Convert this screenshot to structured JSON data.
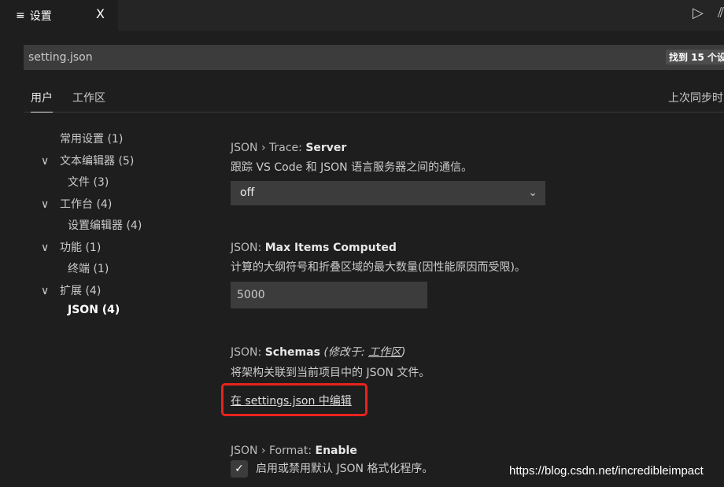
{
  "tab": {
    "icon": "menu-lines-icon",
    "label": "设置",
    "close": "X"
  },
  "actions": {
    "run": "▷",
    "split": "⫽"
  },
  "search": {
    "value": "setting.json",
    "count": "找到 15 个设"
  },
  "scope_tabs": [
    {
      "label": "用户",
      "active": true
    },
    {
      "label": "工作区",
      "active": false
    }
  ],
  "sync": "上次同步时",
  "toc": [
    {
      "label": "常用设置 (1)",
      "chev": ""
    },
    {
      "label": "文本编辑器 (5)",
      "chev": "∨"
    },
    {
      "label": "文件 (3)",
      "chev": "",
      "indent": true
    },
    {
      "label": "工作台 (4)",
      "chev": "∨"
    },
    {
      "label": "设置编辑器 (4)",
      "chev": "",
      "indent": true
    },
    {
      "label": "功能 (1)",
      "chev": "∨"
    },
    {
      "label": "终端 (1)",
      "chev": "",
      "indent": true
    },
    {
      "label": "扩展 (4)",
      "chev": "∨"
    },
    {
      "label": "JSON (4)",
      "chev": "",
      "indent": true,
      "active": true
    }
  ],
  "settings": {
    "trace": {
      "prefix": "JSON › Trace: ",
      "name": "Server",
      "desc": "跟踪 VS Code 和 JSON 语言服务器之间的通信。",
      "value": "off"
    },
    "max": {
      "prefix": "JSON: ",
      "name": "Max Items Computed",
      "desc": "计算的大纲符号和折叠区域的最大数量(因性能原因而受限)。",
      "value": "5000"
    },
    "schemas": {
      "prefix": "JSON: ",
      "name": "Schemas",
      "modified": "(修改于: ",
      "modified_link": "工作区",
      "modified_end": ")",
      "desc": "将架构关联到当前项目中的 JSON 文件。",
      "link": "在 settings.json 中编辑"
    },
    "format": {
      "prefix": "JSON › Format: ",
      "name": "Enable",
      "desc": "启用或禁用默认 JSON 格式化程序。",
      "checked": true
    }
  },
  "watermark": "https://blog.csdn.net/incredibleimpact",
  "colors": {
    "highlight": "#e8231c"
  }
}
